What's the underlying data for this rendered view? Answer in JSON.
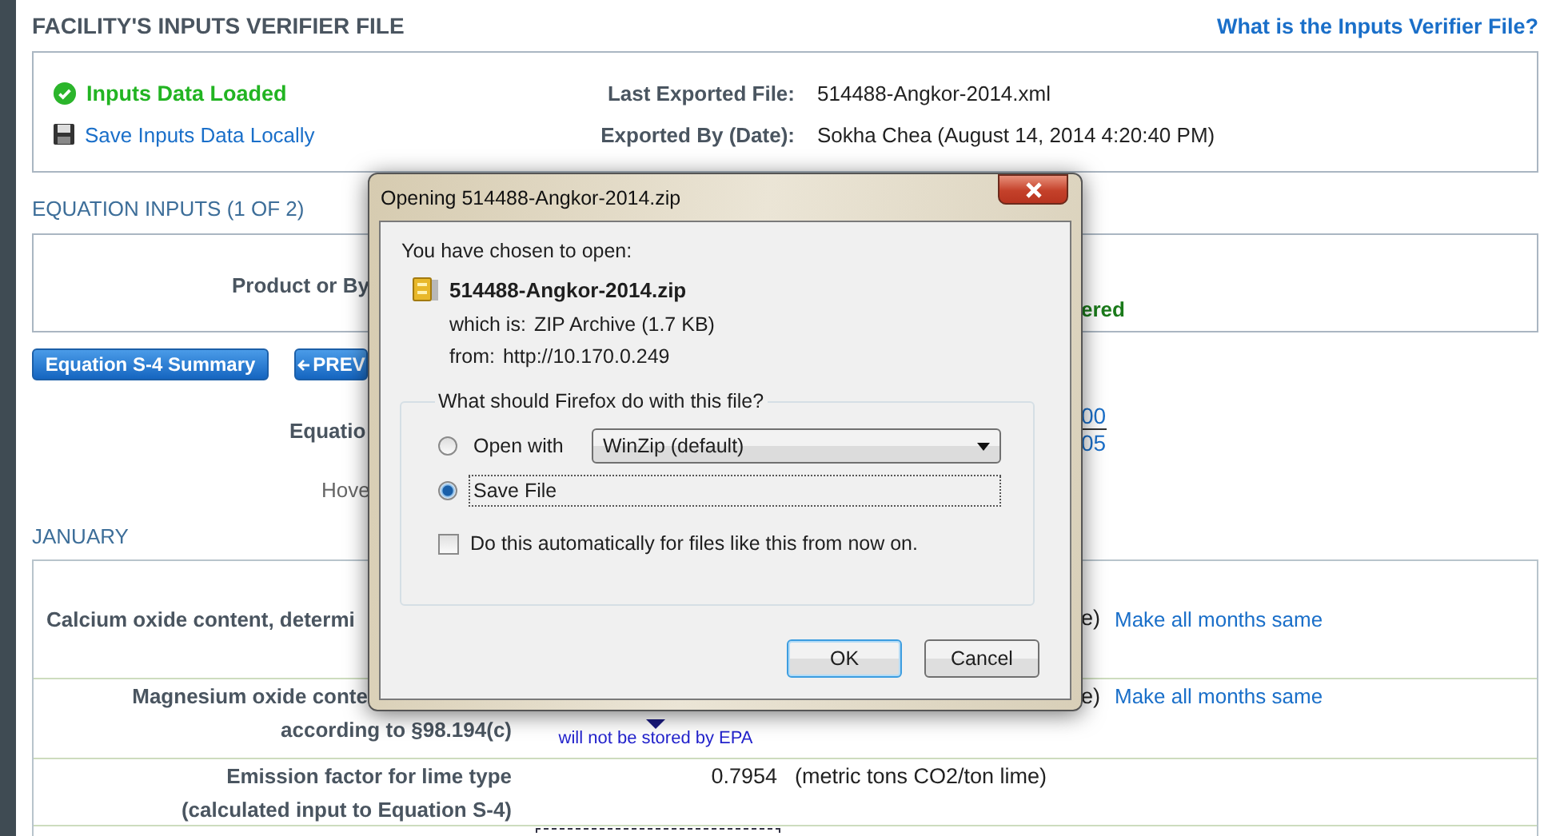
{
  "header": {
    "title": "FACILITY'S INPUTS VERIFIER FILE",
    "help_link": "What is the Inputs Verifier File?"
  },
  "status_box": {
    "loaded": "Inputs Data Loaded",
    "save_link": "Save Inputs Data Locally",
    "fields": [
      {
        "label": "Last Exported File:",
        "value": "514488-Angkor-2014.xml"
      },
      {
        "label": "Exported By (Date):",
        "value": "Sokha Chea (August 14, 2014 4:20:40 PM)"
      }
    ]
  },
  "equation_inputs": {
    "heading": "EQUATION INPUTS (1 OF 2)",
    "product_label": "Product or By",
    "status_text": "ered",
    "buttons": [
      {
        "label": "Equation S-4 Summary",
        "kind": "summary"
      },
      {
        "label": "PREV",
        "kind": "prev"
      }
    ],
    "equation_label": "Equatio",
    "fraction": {
      "numerator": "00",
      "denominator": "05"
    },
    "hover_hint": "Hove"
  },
  "month": {
    "heading": "JANUARY",
    "rows": [
      {
        "kind": "input",
        "label": [
          "Calcium oxide content, determi"
        ],
        "unit": "e)",
        "link": "Make all months same"
      },
      {
        "kind": "input",
        "label": [
          "Magnesium oxide conte",
          "according to §98.194(c)"
        ],
        "note": "will not be stored by EPA",
        "unit": "e)",
        "link": "Make all months same"
      },
      {
        "kind": "input",
        "label": [
          "Emission factor for lime type",
          "(calculated input to Equation S-4)"
        ],
        "value": "0.7954",
        "unit": "(metric tons CO2/ton lime)"
      },
      {
        "kind": "partial"
      }
    ]
  },
  "dialog": {
    "title": "Opening 514488-Angkor-2014.zip",
    "intro": "You have chosen to open:",
    "file_name": "514488-Angkor-2014.zip",
    "details": [
      {
        "label": "which is:",
        "value": "ZIP Archive (1.7 KB)"
      },
      {
        "label": "from:",
        "value": "http://10.170.0.249"
      }
    ],
    "question": "What should Firefox do with this file?",
    "options": [
      {
        "label": "Open with",
        "selected": false,
        "app": "WinZip (default)"
      },
      {
        "label": "Save File",
        "selected": true
      }
    ],
    "auto_checkbox": {
      "label": "Do this automatically for files like this from now on.",
      "checked": false
    },
    "buttons": [
      {
        "label": "OK",
        "focused": true
      },
      {
        "label": "Cancel",
        "focused": false
      }
    ]
  }
}
